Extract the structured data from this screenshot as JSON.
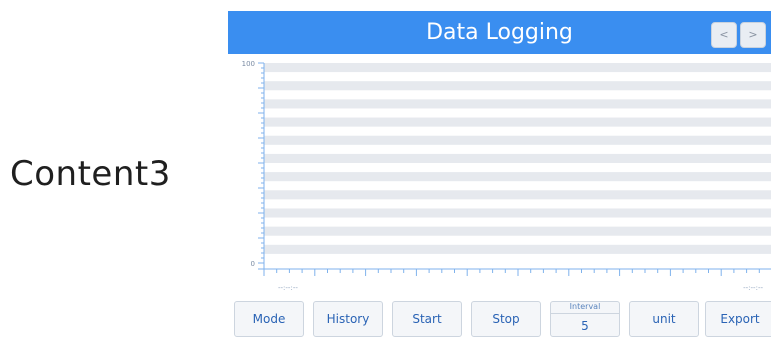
{
  "side_label": "Content3",
  "header": {
    "title": "Data Logging",
    "prev_label": "<",
    "next_label": ">"
  },
  "colors": {
    "title_bar": "#3a8ef0",
    "grid_band": "#e6e9ee",
    "axis": "#7fb2ec",
    "button_text": "#2a63b5"
  },
  "chart_data": {
    "type": "line",
    "series": [],
    "ylim": [
      0,
      100
    ],
    "y_tick_labels": [
      "100",
      "0"
    ],
    "x_tick_labels": [
      "--:--:--",
      "--:--:--"
    ],
    "grid": true
  },
  "toolbar": {
    "mode_label": "Mode",
    "history_label": "History",
    "start_label": "Start",
    "stop_label": "Stop",
    "interval_label": "Interval",
    "interval_value": "5",
    "unit_label": "unit",
    "export_label": "Export"
  }
}
